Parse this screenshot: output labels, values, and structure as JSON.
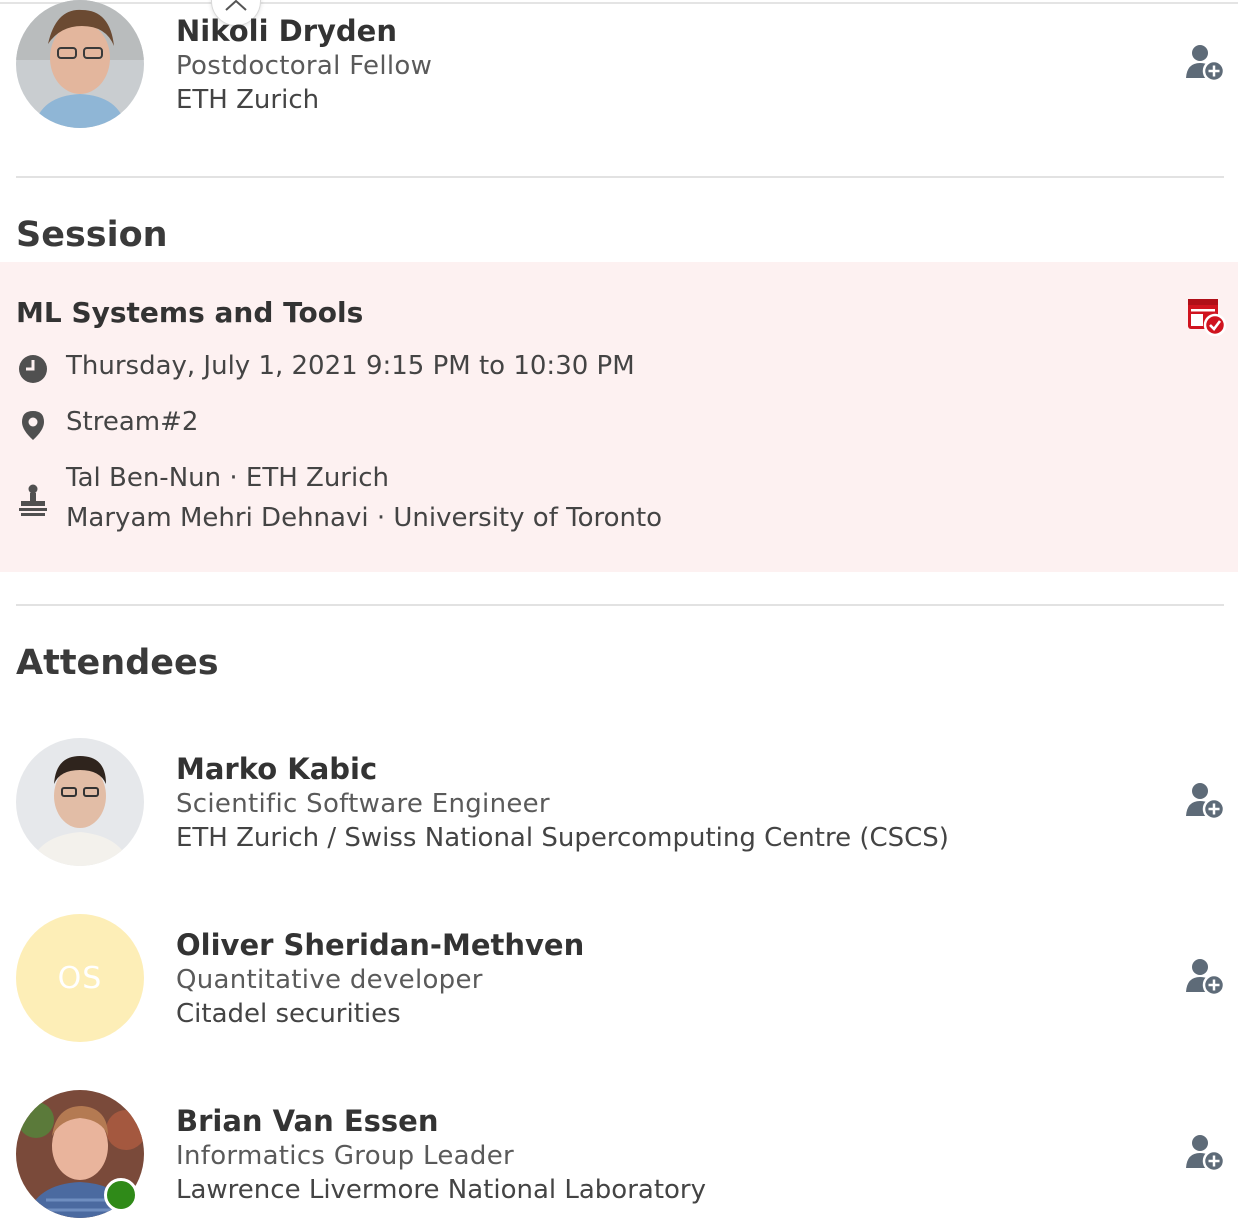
{
  "colors": {
    "accent_red": "#d0141f",
    "icon_gray": "#5e6b78",
    "session_bg": "#fdf1f1",
    "initials_avatar_bg": "#fdeeb7",
    "online_green": "#2f8a18"
  },
  "top_person": {
    "name": "Nikoli Dryden",
    "title": "Postdoctoral Fellow",
    "org": "ETH Zurich",
    "avatar_icon": "person-photo",
    "action_icon": "add-contact-icon"
  },
  "session": {
    "heading": "Session",
    "title": "ML Systems and Tools",
    "datetime": "Thursday, July 1, 2021 9:15 PM to 10:30 PM",
    "location": "Stream#2",
    "chairs": [
      "Tal Ben-Nun · ETH Zurich",
      "Maryam Mehri Dehnavi · University of Toronto"
    ],
    "icons": {
      "time": "clock-icon",
      "location": "location-pin-icon",
      "chairs": "speaker-podium-icon",
      "action": "calendar-added-icon"
    }
  },
  "attendees": {
    "heading": "Attendees",
    "list": [
      {
        "name": "Marko Kabic",
        "title": "Scientific Software Engineer",
        "org": "ETH Zurich / Swiss National Supercomputing Centre (CSCS)",
        "avatar_icon": "person-photo"
      },
      {
        "name": "Oliver Sheridan-Methven",
        "title": "Quantitative developer",
        "org": "Citadel securities",
        "initials": "OS"
      },
      {
        "name": "Brian Van Essen",
        "title": "Informatics Group Leader",
        "org": "Lawrence Livermore National Laboratory",
        "avatar_icon": "person-photo",
        "status": "online"
      }
    ]
  }
}
